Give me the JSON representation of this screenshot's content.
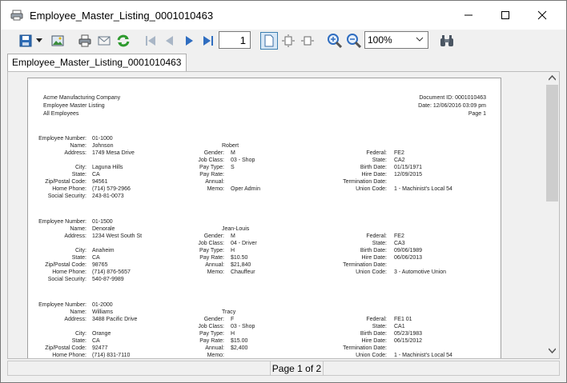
{
  "window": {
    "title": "Employee_Master_Listing_0001010463"
  },
  "toolbar": {
    "page_number": "1",
    "zoom": "100%"
  },
  "tab": {
    "label": "Employee_Master_Listing_0001010463"
  },
  "report": {
    "company": "Acme Manufacturing Company",
    "report_name": "Employee Master Listing",
    "filter": "All Employees",
    "document_id": "Document ID: 0001010463",
    "date": "Date: 12/06/2016  03:09 pm",
    "page": "Page 1"
  },
  "labels": {
    "left": [
      "Employee Number:",
      "Name:",
      "Address:",
      "City:",
      "State:",
      "Zip/Postal Code:",
      "Home Phone:",
      "Social Security:"
    ],
    "mid": [
      "Gender:",
      "Job Class:",
      "Pay Type:",
      "Pay Rate:",
      "Annual:",
      "Memo:"
    ],
    "right": [
      "Federal:",
      "State:",
      "Birth Date:",
      "Hire Date:",
      "Termination Date:",
      "Union Code:"
    ]
  },
  "employees": [
    {
      "number": "01-1000",
      "last": "Johnson",
      "first": "Robert",
      "address": "1749 Mesa Drive",
      "city": "Laguna Hills",
      "state": "CA",
      "zip": "94561",
      "phone": "(714) 579-2966",
      "ssn": "243-81-0073",
      "gender": "M",
      "job_class": "03 - Shop",
      "pay_type": "S",
      "pay_rate": "",
      "annual": "",
      "memo": "Oper Admin",
      "federal": "FE2",
      "state_tax": "CA2",
      "birth": "01/15/1971",
      "hire": "12/09/2015",
      "term": "",
      "union": "1 -  Machinist's Local 54"
    },
    {
      "number": "01-1500",
      "last": "Denorale",
      "first": "Jean-Louis",
      "address": "1234 West South St",
      "city": "Anaheim",
      "state": "CA",
      "zip": "98765",
      "phone": "(714) 876-5657",
      "ssn": "540-87-9989",
      "gender": "M",
      "job_class": "04 - Driver",
      "pay_type": "H",
      "pay_rate": "$10.50",
      "annual": "$21,840",
      "memo": "Chauffeur",
      "federal": "FE2",
      "state_tax": "CA3",
      "birth": "09/06/1989",
      "hire": "06/06/2013",
      "term": "",
      "union": "3 -  Automotive Union"
    },
    {
      "number": "01-2000",
      "last": "Williams",
      "first": "Tracy",
      "address": "3488 Pacific Drive",
      "city": "Orange",
      "state": "CA",
      "zip": "92477",
      "phone": "(714) 831-7110",
      "ssn": "",
      "gender": "F",
      "job_class": "03 - Shop",
      "pay_type": "H",
      "pay_rate": "$15.00",
      "annual": "$2,400",
      "memo": "",
      "federal": "FE1 01",
      "state_tax": "CA1",
      "birth": "05/23/1983",
      "hire": "06/15/2012",
      "term": "",
      "union": "1 -  Machinist's Local 54"
    }
  ],
  "status": {
    "page_status": "Page 1 of 2"
  },
  "icons": [
    "printer-app-icon",
    "save-icon",
    "dropdown-arrow-icon",
    "export-image-icon",
    "print-icon",
    "email-icon",
    "refresh-icon",
    "first-page-icon",
    "previous-page-icon",
    "next-page-icon",
    "last-page-icon",
    "single-page-icon",
    "fit-page-icon",
    "fit-width-icon",
    "zoom-in-icon",
    "zoom-out-icon",
    "find-icon"
  ]
}
